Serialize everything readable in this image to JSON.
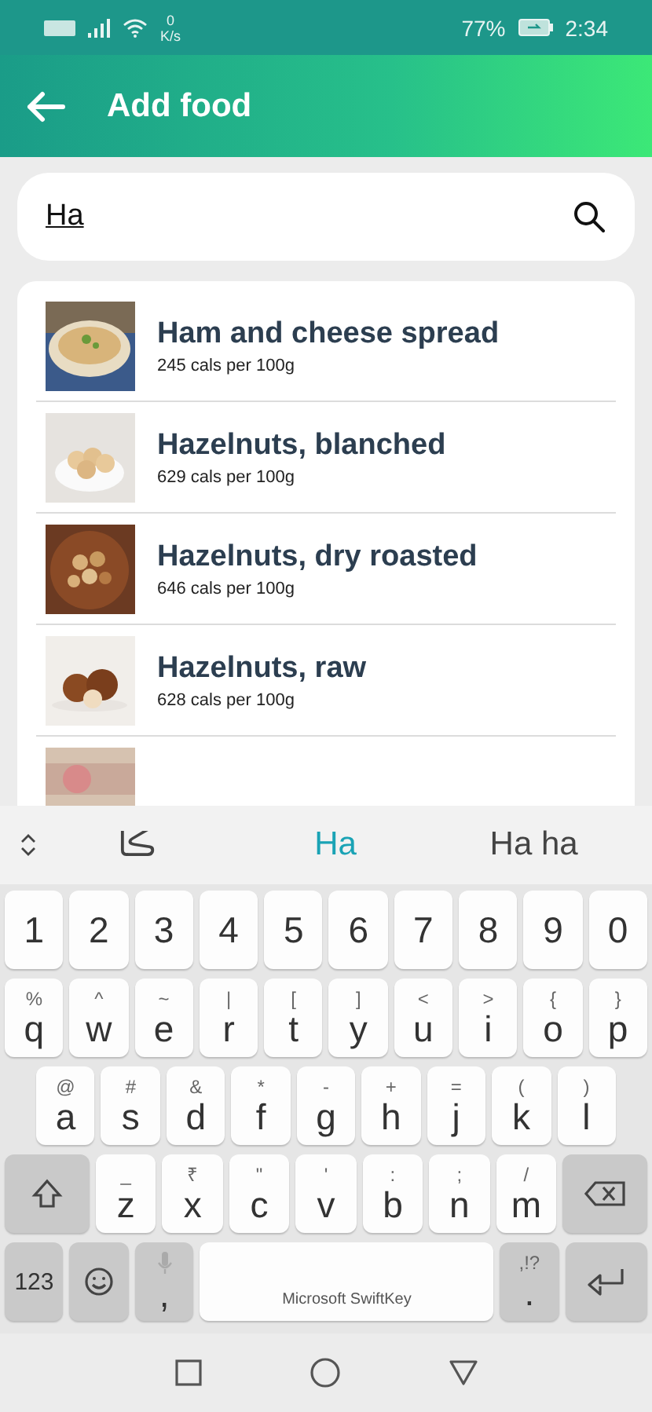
{
  "status_bar": {
    "speed_value": "0",
    "speed_unit": "K/s",
    "battery": "77%",
    "time": "2:34"
  },
  "header": {
    "title": "Add food"
  },
  "search": {
    "value": "Ha"
  },
  "foods": [
    {
      "kind": "food",
      "name": "Ham and cheese spread",
      "calories": "245 cals per 100g"
    },
    {
      "kind": "food",
      "name": "Hazelnuts, blanched",
      "calories": "629 cals per 100g"
    },
    {
      "kind": "food",
      "name": "Hazelnuts, dry roasted",
      "calories": "646 cals per 100g"
    },
    {
      "kind": "food",
      "name": "Hazelnuts, raw",
      "calories": "628 cals per 100g"
    },
    {
      "kind": "partial"
    }
  ],
  "keyboard": {
    "suggestions": [
      {
        "text": "ڪا",
        "selected": false
      },
      {
        "text": "Ha",
        "selected": true
      },
      {
        "text": "Ha ha",
        "selected": false
      }
    ],
    "number_row": [
      {
        "kind": "char",
        "main": "1"
      },
      {
        "kind": "char",
        "main": "2"
      },
      {
        "kind": "char",
        "main": "3"
      },
      {
        "kind": "char",
        "main": "4"
      },
      {
        "kind": "char",
        "main": "5"
      },
      {
        "kind": "char",
        "main": "6"
      },
      {
        "kind": "char",
        "main": "7"
      },
      {
        "kind": "char",
        "main": "8"
      },
      {
        "kind": "char",
        "main": "9"
      },
      {
        "kind": "char",
        "main": "0"
      }
    ],
    "top_row": [
      {
        "kind": "char",
        "main": "q",
        "alt": "%"
      },
      {
        "kind": "char",
        "main": "w",
        "alt": "^"
      },
      {
        "kind": "char",
        "main": "e",
        "alt": "~"
      },
      {
        "kind": "char",
        "main": "r",
        "alt": "|"
      },
      {
        "kind": "char",
        "main": "t",
        "alt": "["
      },
      {
        "kind": "char",
        "main": "y",
        "alt": "]"
      },
      {
        "kind": "char",
        "main": "u",
        "alt": "<"
      },
      {
        "kind": "char",
        "main": "i",
        "alt": ">"
      },
      {
        "kind": "char",
        "main": "o",
        "alt": "{"
      },
      {
        "kind": "char",
        "main": "p",
        "alt": "}"
      }
    ],
    "home_row": [
      {
        "kind": "char",
        "main": "a",
        "alt": "@"
      },
      {
        "kind": "char",
        "main": "s",
        "alt": "#"
      },
      {
        "kind": "char",
        "main": "d",
        "alt": "&"
      },
      {
        "kind": "char",
        "main": "f",
        "alt": "*"
      },
      {
        "kind": "char",
        "main": "g",
        "alt": "-"
      },
      {
        "kind": "char",
        "main": "h",
        "alt": "+"
      },
      {
        "kind": "char",
        "main": "j",
        "alt": "="
      },
      {
        "kind": "char",
        "main": "k",
        "alt": "("
      },
      {
        "kind": "char",
        "main": "l",
        "alt": ")"
      }
    ],
    "bottom_row": [
      {
        "kind": "shift"
      },
      {
        "kind": "char",
        "main": "z",
        "alt": "_"
      },
      {
        "kind": "char",
        "main": "x",
        "alt": "₹"
      },
      {
        "kind": "char",
        "main": "c",
        "alt": "\""
      },
      {
        "kind": "char",
        "main": "v",
        "alt": "'"
      },
      {
        "kind": "char",
        "main": "b",
        "alt": ":"
      },
      {
        "kind": "char",
        "main": "n",
        "alt": ";"
      },
      {
        "kind": "char",
        "main": "m",
        "alt": "/"
      },
      {
        "kind": "backspace"
      }
    ],
    "function_row": [
      {
        "kind": "mode",
        "main": "123"
      },
      {
        "kind": "emoji"
      },
      {
        "kind": "mic",
        "main": ","
      },
      {
        "kind": "space",
        "main": "Microsoft SwiftKey"
      },
      {
        "kind": "punct",
        "main": ".",
        "alt": ",!?"
      },
      {
        "kind": "enter"
      }
    ]
  }
}
